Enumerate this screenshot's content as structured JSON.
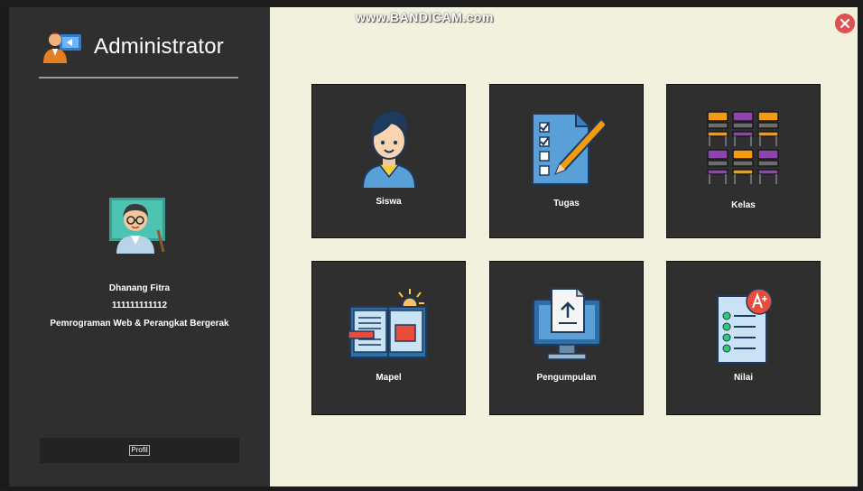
{
  "header": {
    "title": "Administrator",
    "watermark": "www.BANDICAM.com",
    "close_icon": "close-icon"
  },
  "user": {
    "name": "Dhanang Fitra",
    "id": "111111111112",
    "department": "Pemrograman Web & Perangkat Bergerak",
    "avatar_icon": "teacher-avatar-icon"
  },
  "sidebar": {
    "profile_label": "Profil"
  },
  "tiles": [
    {
      "label": "Siswa",
      "icon": "student-icon"
    },
    {
      "label": "Tugas",
      "icon": "checklist-icon"
    },
    {
      "label": "Kelas",
      "icon": "classroom-icon"
    },
    {
      "label": "Mapel",
      "icon": "book-icon"
    },
    {
      "label": "Pengumpulan",
      "icon": "upload-icon"
    },
    {
      "label": "Nilai",
      "icon": "grade-icon"
    }
  ],
  "colors": {
    "sidebar_bg": "#2f2f2f",
    "main_bg": "#f2f1dd",
    "tile_bg": "#2f2f2f",
    "close_red": "#e05050"
  }
}
